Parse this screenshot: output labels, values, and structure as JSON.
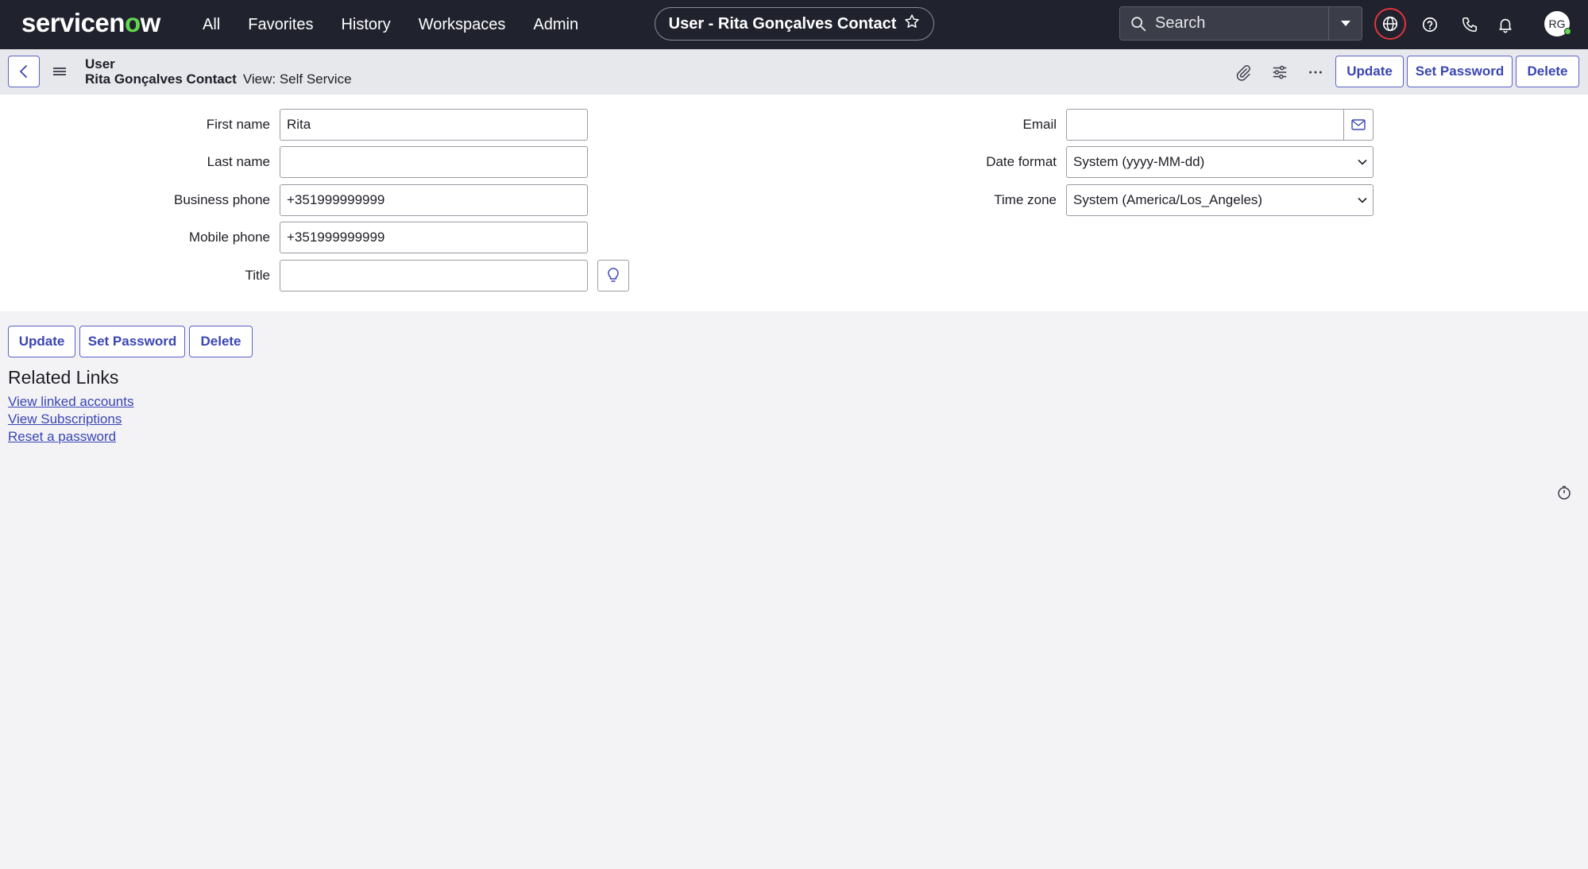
{
  "nav": {
    "logo_pre": "servicen",
    "logo_o": "o",
    "logo_post": "w",
    "links": [
      "All",
      "Favorites",
      "History",
      "Workspaces",
      "Admin"
    ],
    "context_title": "User - Rita Gonçalves Contact",
    "search_placeholder": "Search",
    "avatar_initials": "RG"
  },
  "form_header": {
    "record_type": "User",
    "record_name": "Rita Gonçalves Contact",
    "view_label": "View: Self Service",
    "buttons": {
      "update": "Update",
      "set_password": "Set Password",
      "delete": "Delete"
    }
  },
  "form": {
    "left": [
      {
        "label": "First name",
        "value": "Rita"
      },
      {
        "label": "Last name",
        "value": ""
      },
      {
        "label": "Business phone",
        "value": "+351999999999"
      },
      {
        "label": "Mobile phone",
        "value": "+351999999999"
      },
      {
        "label": "Title",
        "value": ""
      }
    ],
    "right": [
      {
        "label": "Email",
        "value": ""
      },
      {
        "label": "Date format",
        "value": "System (yyyy-MM-dd)"
      },
      {
        "label": "Time zone",
        "value": "System (America/Los_Angeles)"
      }
    ]
  },
  "bottom_buttons": {
    "update": "Update",
    "set_password": "Set Password",
    "delete": "Delete"
  },
  "related_links": {
    "title": "Related Links",
    "links": [
      "View linked accounts",
      "View Subscriptions",
      "Reset a password"
    ]
  },
  "colors": {
    "nav_bg": "#20222d",
    "accent": "#3a45b5",
    "logo_green": "#62d84e",
    "alert_red": "#e0353f"
  }
}
